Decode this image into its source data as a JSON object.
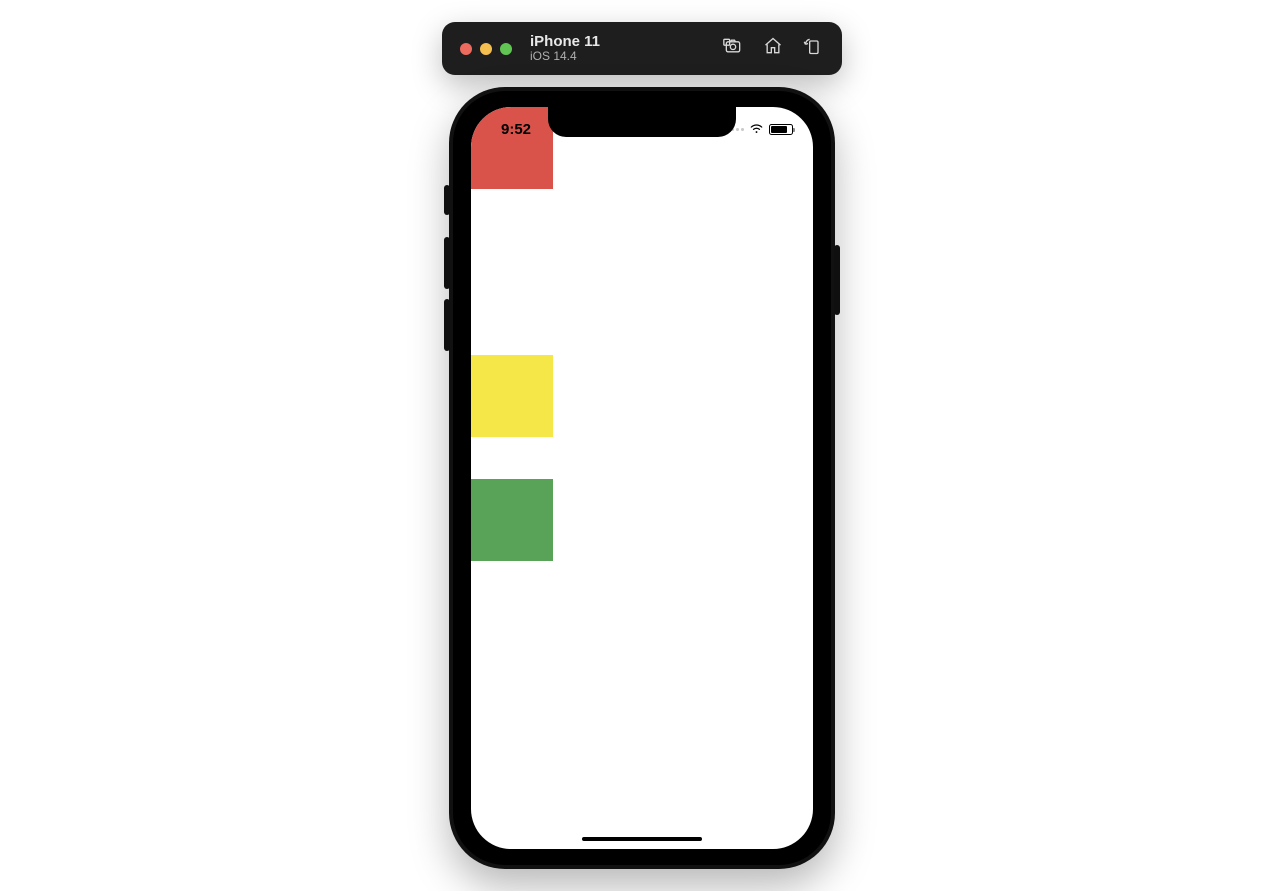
{
  "simulator": {
    "device_name": "iPhone 11",
    "os_version": "iOS 14.4"
  },
  "status_bar": {
    "time": "9:52"
  },
  "colors": {
    "box1": "#d9534a",
    "box2": "#f6e749",
    "box3": "#59a359"
  }
}
